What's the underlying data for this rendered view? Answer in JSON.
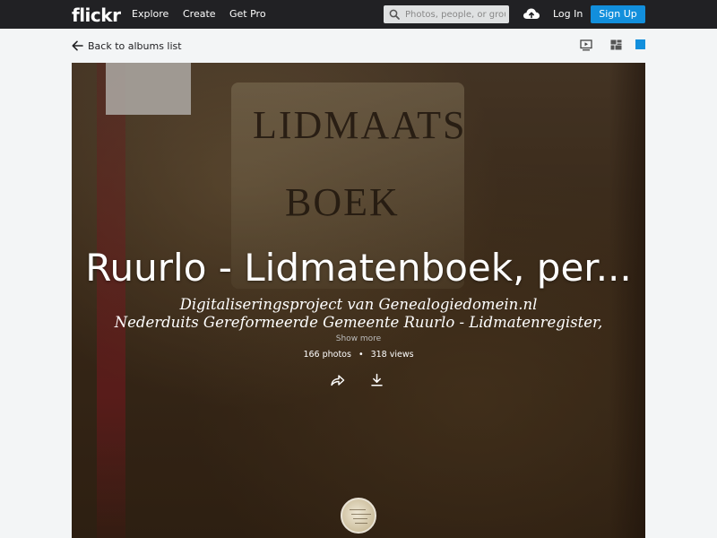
{
  "header": {
    "logo": "flickr",
    "nav": [
      "Explore",
      "Create",
      "Get Pro"
    ],
    "search_placeholder": "Photos, people, or groups",
    "login_label": "Log In",
    "signup_label": "Sign Up"
  },
  "toolbar": {
    "back_label": "Back to albums list"
  },
  "album": {
    "cover_text_line1": "LIDMAATS",
    "cover_text_line2": "BOEK",
    "title": "Ruurlo - Lidmatenboek, per...",
    "description_line1": "Digitaliseringsproject van Genealogiedomein.nl",
    "description_line2": "Nederduits Gereformeerde Gemeente Ruurlo - Lidmatenregister,",
    "show_more_label": "Show more",
    "photos_count": "166 photos",
    "separator": "•",
    "views_count": "318 views"
  },
  "colors": {
    "topbar": "#212124",
    "accent": "#128fdc",
    "page_bg": "#f3f5f6"
  },
  "icons": [
    "search-icon",
    "upload-cloud-icon",
    "arrow-left-icon",
    "slideshow-icon",
    "grid-icon",
    "cover-view-icon",
    "share-icon",
    "download-icon"
  ]
}
